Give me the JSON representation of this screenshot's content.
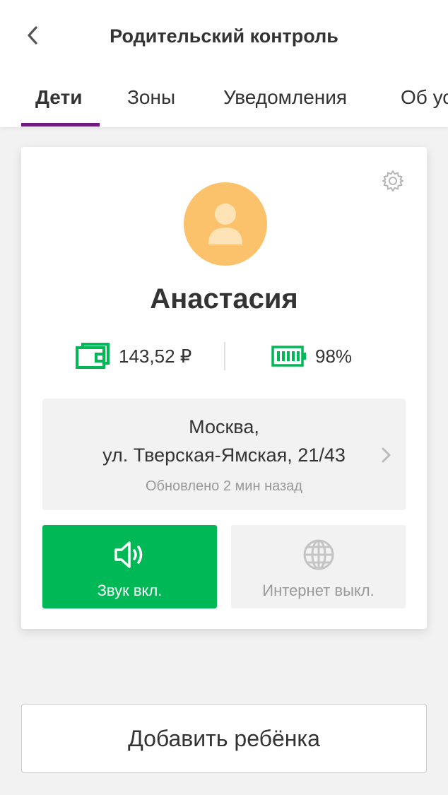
{
  "header": {
    "title": "Родительский контроль",
    "back_icon": "chevron-left-icon"
  },
  "tabs": [
    {
      "label": "Дети",
      "active": true
    },
    {
      "label": "Зоны",
      "active": false
    },
    {
      "label": "Уведомления",
      "active": false
    },
    {
      "label": "Об услуге",
      "active": false
    }
  ],
  "accent_color": "#731982",
  "child_card": {
    "settings_icon": "gear-icon",
    "avatar_icon": "person-icon",
    "avatar_color": "#fcc26b",
    "name": "Анастасия",
    "balance": "143,52 ₽",
    "balance_icon": "wallet-icon",
    "battery": "98%",
    "battery_icon": "battery-icon",
    "status_color": "#00b956",
    "location": {
      "line1": "Москва,",
      "line2": "ул. Тверская-Ямская, 21/43",
      "updated": "Обновлено 2 мин назад",
      "chevron_icon": "chevron-right-icon"
    },
    "sound_button": {
      "label": "Звук вкл.",
      "icon": "speaker-icon",
      "on": true
    },
    "internet_button": {
      "label": "Интернет выкл.",
      "icon": "globe-icon",
      "on": false
    }
  },
  "add_child_label": "Добавить ребёнка"
}
